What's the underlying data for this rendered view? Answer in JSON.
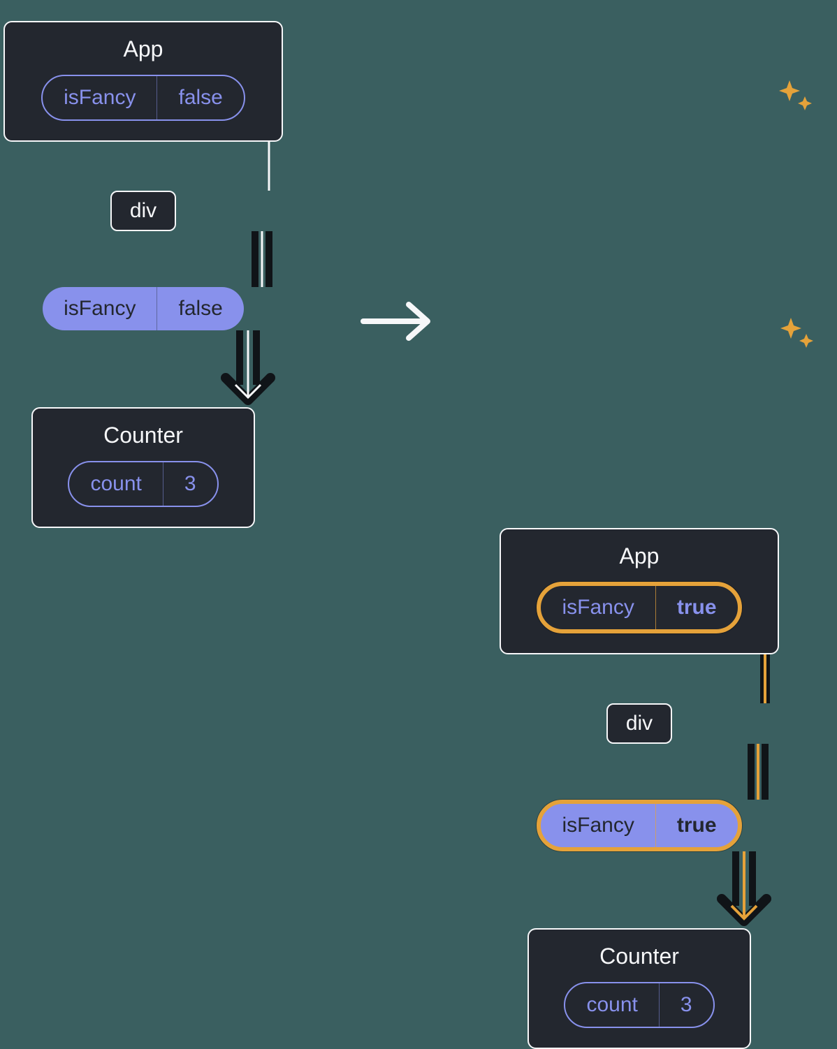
{
  "left": {
    "app": {
      "title": "App",
      "prop": "isFancy",
      "value": "false"
    },
    "mid": {
      "label": "div"
    },
    "freepill": {
      "prop": "isFancy",
      "value": "false"
    },
    "counter": {
      "title": "Counter",
      "prop": "count",
      "value": "3"
    }
  },
  "right": {
    "app": {
      "title": "App",
      "prop": "isFancy",
      "value": "true"
    },
    "mid": {
      "label": "div"
    },
    "freepill": {
      "prop": "isFancy",
      "value": "true"
    },
    "counter": {
      "title": "Counter",
      "prop": "count",
      "value": "3"
    }
  },
  "colors": {
    "bg": "#3a5f60",
    "box": "#23272f",
    "outline": "#f6f7f9",
    "accent": "#8891ec",
    "highlight": "#e5a23a"
  }
}
